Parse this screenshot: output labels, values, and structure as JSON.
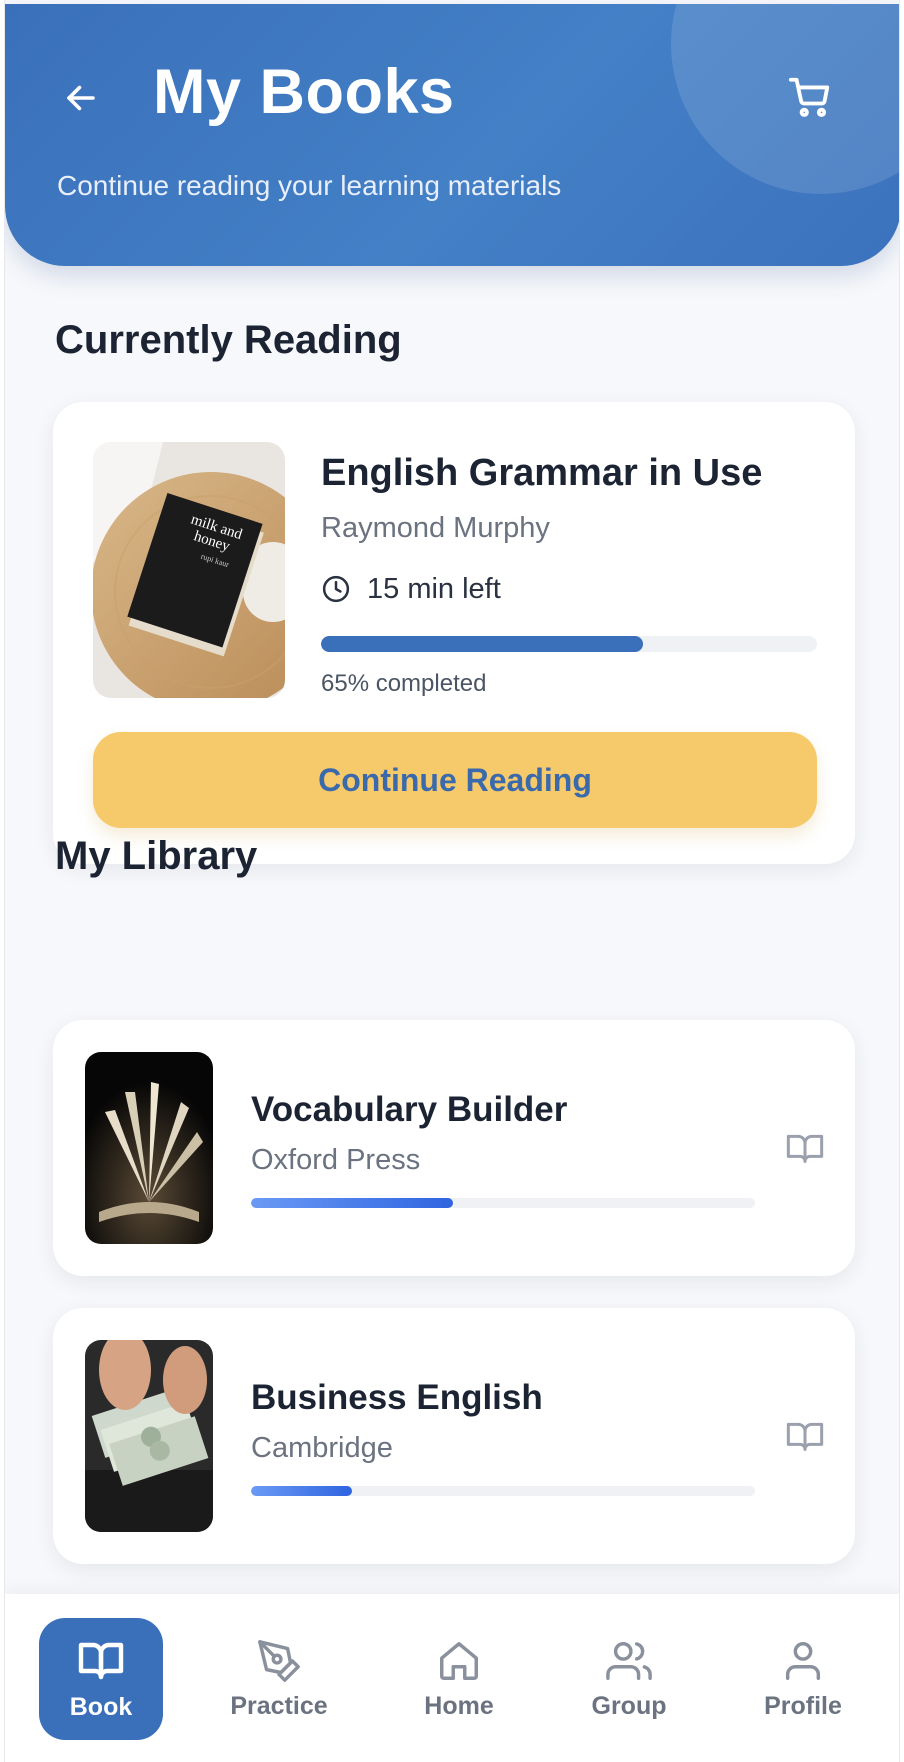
{
  "header": {
    "title": "My Books",
    "subtitle": "Continue reading your learning materials",
    "back_icon": "arrow-left-icon",
    "cart_icon": "cart-icon"
  },
  "current_section": {
    "title": "Currently Reading",
    "book": {
      "title": "English Grammar in Use",
      "author": "Raymond Murphy",
      "time_left": "15 min left",
      "progress": 0.65,
      "progress_label": "65% completed",
      "cover_text": "milk and honey",
      "cover_author": "rupi kaur"
    },
    "continue_label": "Continue Reading"
  },
  "library_section": {
    "title": "My Library",
    "books": [
      {
        "title": "Vocabulary Builder",
        "author": "Oxford Press",
        "progress": 0.4
      },
      {
        "title": "Business English",
        "author": "Cambridge",
        "progress": 0.2
      }
    ]
  },
  "nav": {
    "items": [
      {
        "label": "Book",
        "icon": "book-icon",
        "active": true
      },
      {
        "label": "Practice",
        "icon": "pen-icon",
        "active": false
      },
      {
        "label": "Home",
        "icon": "home-icon",
        "active": false
      },
      {
        "label": "Group",
        "icon": "group-icon",
        "active": false
      },
      {
        "label": "Profile",
        "icon": "profile-icon",
        "active": false
      }
    ]
  },
  "colors": {
    "primary": "#3a6fba",
    "accent": "#f6c96a",
    "text_dark": "#1c2433",
    "text_muted": "#6b7280"
  }
}
